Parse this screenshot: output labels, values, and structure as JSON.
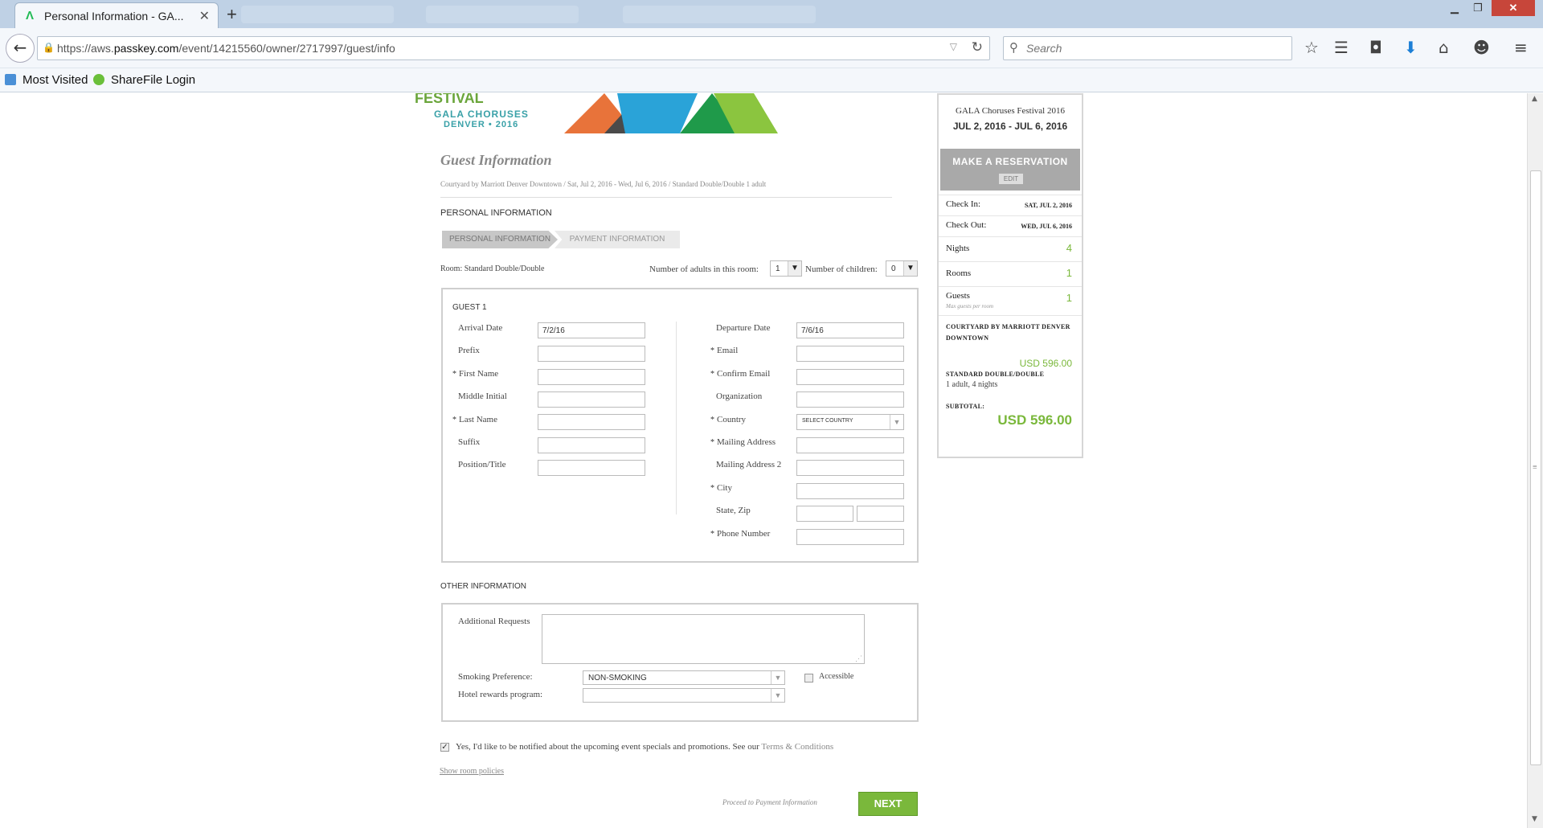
{
  "browser": {
    "tab_title": "Personal Information - GA...",
    "url_prefix": "https://aws.",
    "url_domain": "passkey.com",
    "url_path": "/event/14215560/owner/2717997/guest/info",
    "search_placeholder": "Search",
    "bookmarks": [
      "Most Visited",
      "ShareFile Login"
    ]
  },
  "logo": {
    "line1": "GALA CHORUSES",
    "line2": "DENVER • 2016",
    "colors": [
      "#e8733a",
      "#4a4a4a",
      "#2aa3d8",
      "#1f9a4a",
      "#8bc53f"
    ]
  },
  "page": {
    "heading": "Guest Information",
    "breadcrumb": "Courtyard by Marriott Denver Downtown / Sat, Jul 2, 2016 - Wed, Jul 6, 2016 / Standard Double/Double 1 adult",
    "section_personal": "PERSONAL INFORMATION",
    "steps": [
      "PERSONAL INFORMATION",
      "PAYMENT INFORMATION"
    ],
    "room_label": "Room: Standard Double/Double",
    "adults_label": "Number of adults in this room:",
    "adults_value": "1",
    "children_label": "Number of children:",
    "children_value": "0",
    "guest_heading": "GUEST 1",
    "left_fields": {
      "arrival_label": "Arrival Date",
      "arrival_value": "7/2/16",
      "prefix_label": "Prefix",
      "first_label": "First Name",
      "middle_label": "Middle Initial",
      "last_label": "Last Name",
      "suffix_label": "Suffix",
      "position_label": "Position/Title"
    },
    "right_fields": {
      "departure_label": "Departure Date",
      "departure_value": "7/6/16",
      "email_label": "Email",
      "confirm_label": "Confirm Email",
      "org_label": "Organization",
      "country_label": "Country",
      "country_value": "SELECT COUNTRY",
      "mail1_label": "Mailing Address",
      "mail2_label": "Mailing Address 2",
      "city_label": "City",
      "statezip_label": "State, Zip",
      "phone_label": "Phone Number"
    },
    "required_mark": "*",
    "section_other": "OTHER INFORMATION",
    "requests_label": "Additional Requests",
    "smoking_label": "Smoking Preference:",
    "smoking_value": "NON-SMOKING",
    "accessible_label": "Accessible",
    "rewards_label": "Hotel rewards program:",
    "notify_text": "Yes, I'd like to be notified about the upcoming event specials and promotions. See our",
    "terms_link": "Terms & Conditions",
    "room_policies_link": "Show room policies",
    "proceed_text": "Proceed to Payment Information",
    "next_label": "NEXT"
  },
  "sidebar": {
    "event_name": "GALA Choruses Festival 2016",
    "event_dates": "JUL 2, 2016 - JUL 6, 2016",
    "make_reservation": "MAKE A RESERVATION",
    "edit_label": "EDIT",
    "checkin_label": "Check In:",
    "checkin_value": "SAT, JUL 2, 2016",
    "checkout_label": "Check Out:",
    "checkout_value": "WED, JUL 6, 2016",
    "nights_label": "Nights",
    "nights_value": "4",
    "rooms_label": "Rooms",
    "rooms_value": "1",
    "guests_label": "Guests",
    "guests_value": "1",
    "guests_note": "Max guests per room",
    "hotel": "COURTYARD BY MARRIOTT DENVER DOWNTOWN",
    "room_price": "USD 596.00",
    "room_type": "STANDARD DOUBLE/DOUBLE",
    "room_detail": "1 adult, 4 nights",
    "subtotal_label": "SUBTOTAL:",
    "subtotal_value": "USD 596.00"
  }
}
